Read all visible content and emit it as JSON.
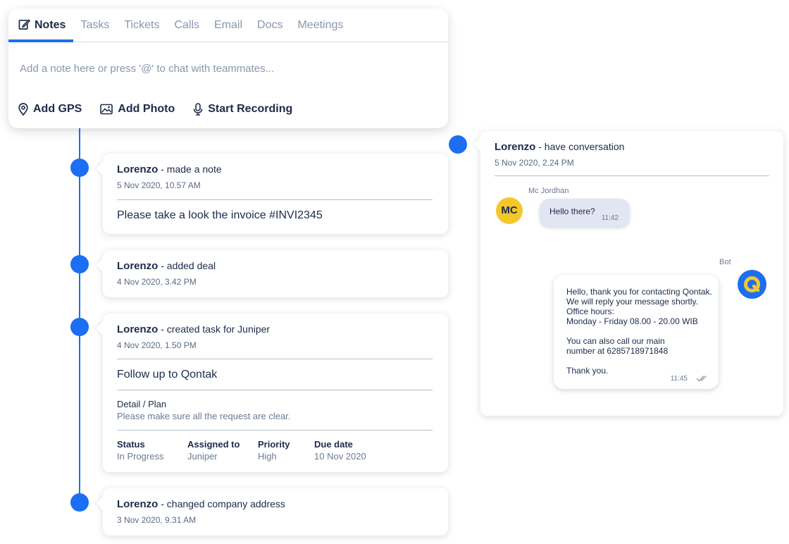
{
  "composer": {
    "tabs": [
      {
        "label": "Notes",
        "icon": "edit-note-icon",
        "active": true
      },
      {
        "label": "Tasks"
      },
      {
        "label": "Tickets"
      },
      {
        "label": "Calls"
      },
      {
        "label": "Email"
      },
      {
        "label": "Docs"
      },
      {
        "label": "Meetings"
      }
    ],
    "placeholder": "Add a note here or press '@' to chat with teammates...",
    "actions": [
      {
        "label": "Add GPS",
        "icon": "location-pin-icon"
      },
      {
        "label": "Add Photo",
        "icon": "image-icon"
      },
      {
        "label": "Start Recording",
        "icon": "microphone-icon"
      }
    ]
  },
  "activities": [
    {
      "author": "Lorenzo",
      "action": "- made a note",
      "date": "5 Nov 2020, 10.57 AM",
      "body": "Please take a look the invoice #INVI2345"
    },
    {
      "author": "Lorenzo",
      "action": "- added deal",
      "date": "4 Nov 2020, 3.42 PM"
    },
    {
      "author": "Lorenzo",
      "action": "- created task for Juniper",
      "date": "4 Nov 2020, 1.50 PM",
      "task_title": "Follow up to Qontak",
      "detail_label": "Detail / Plan",
      "detail_text": "Please make sure all the request are clear.",
      "fields": [
        {
          "key": "Status",
          "value": "In Progress"
        },
        {
          "key": "Assigned to",
          "value": "Juniper"
        },
        {
          "key": "Priority",
          "value": "High"
        },
        {
          "key": "Due date",
          "value": "10 Nov 2020"
        }
      ]
    },
    {
      "author": "Lorenzo",
      "action": "- changed company address",
      "date": "3 Nov 2020, 9.31 AM"
    }
  ],
  "conversation": {
    "author": "Lorenzo",
    "action": "- have conversation",
    "date": "5 Nov 2020, 2.24 PM",
    "incoming": {
      "sender": "Mc Jordhan",
      "initials": "MC",
      "text": "Hello there?",
      "time": "11:42"
    },
    "outgoing": {
      "sender": "Bot",
      "lines": [
        "Hello, thank you for contacting Qontak.",
        "We will reply your message shortly.",
        "Office hours:",
        "Monday - Friday 08.00 - 20.00 WIB",
        "",
        "You can also call our main",
        "number at 6285718971848",
        "",
        "Thank you."
      ],
      "time": "11:45",
      "status_icon": "double-check-icon"
    }
  },
  "colors": {
    "accent": "#1c6ef2",
    "text": "#1c2b4a",
    "muted": "#8a96ad",
    "avatar_yellow": "#f5c72a"
  }
}
